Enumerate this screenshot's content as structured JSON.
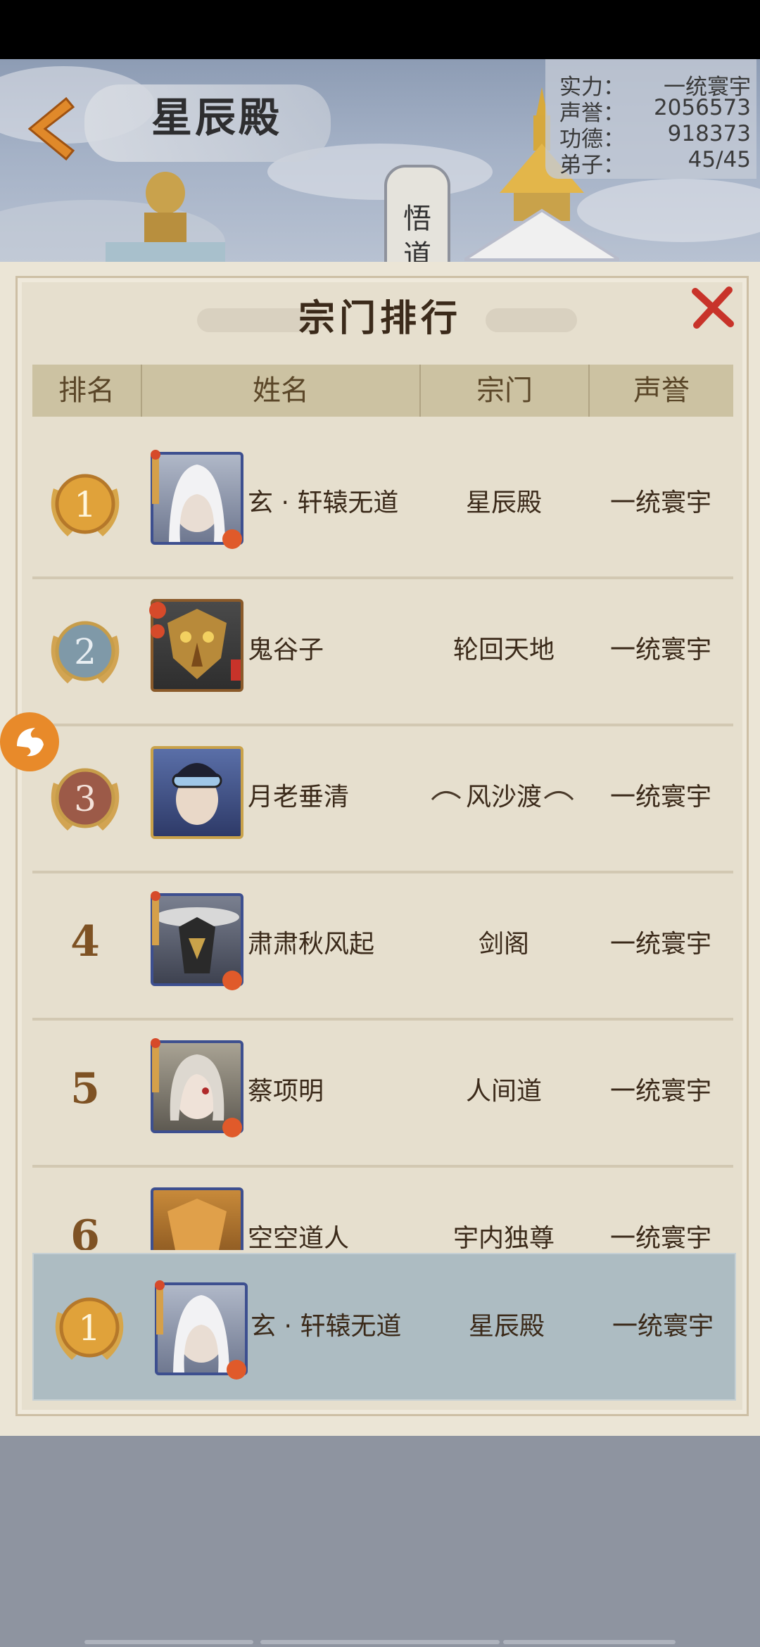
{
  "scene": {
    "title": "星辰殿",
    "stats": [
      {
        "label": "实力：",
        "value": "一统寰宇"
      },
      {
        "label": "声誉：",
        "value": "2056573"
      },
      {
        "label": "功德：",
        "value": "918373"
      },
      {
        "label": "弟子：",
        "value": "45/45"
      }
    ],
    "side_tab": [
      "悟",
      "道"
    ]
  },
  "panel": {
    "title": "宗门排行",
    "columns": [
      "排名",
      "姓名",
      "宗门",
      "声誉"
    ]
  },
  "rows": [
    {
      "rank": "1",
      "name": "玄 · 轩辕无道",
      "sect": "星辰殿",
      "fame": "一统寰宇"
    },
    {
      "rank": "2",
      "name": "鬼谷子",
      "sect": "轮回天地",
      "fame": "一统寰宇"
    },
    {
      "rank": "3",
      "name": "月老垂清",
      "sect": "风沙渡",
      "fame": "一统寰宇"
    },
    {
      "rank": "4",
      "name": "肃肃秋风起",
      "sect": "剑阁",
      "fame": "一统寰宇"
    },
    {
      "rank": "5",
      "name": "蔡项明",
      "sect": "人间道",
      "fame": "一统寰宇"
    },
    {
      "rank": "6",
      "name": "空空道人",
      "sect": "宇内独尊",
      "fame": "一统寰宇"
    }
  ],
  "my_rank": {
    "rank": "1",
    "name": "玄 · 轩辕无道",
    "sect": "星辰殿",
    "fame": "一统寰宇"
  },
  "colors": {
    "gold_medal": "#e0a23a",
    "silver_medal": "#7f99a8",
    "bronze_medal": "#9c5a48",
    "close_red": "#c8332a",
    "highlight_row": "#adbcc2"
  }
}
